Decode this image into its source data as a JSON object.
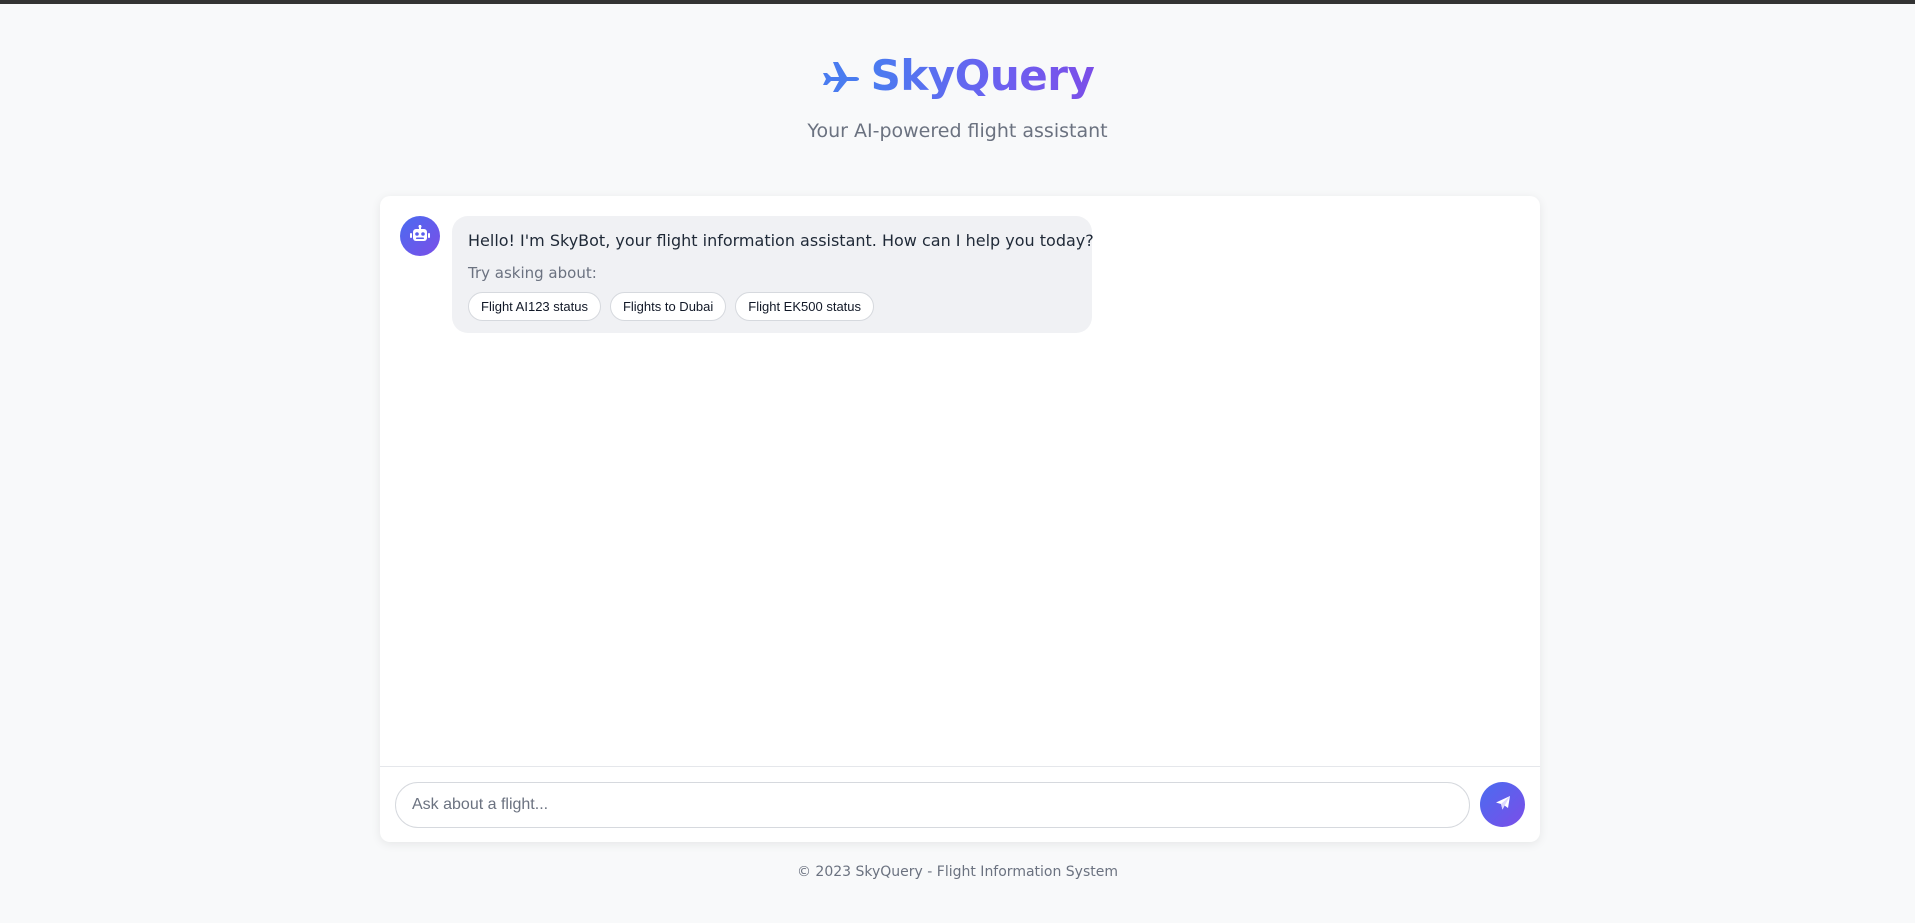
{
  "header": {
    "logo_icon": "airplane-icon",
    "title": "SkyQuery",
    "subtitle": "Your AI-powered flight assistant"
  },
  "colors": {
    "accent_start": "#4a7cf0",
    "accent_end": "#7b4ee8",
    "background": "#f8f9fa",
    "bubble": "#f0f1f4"
  },
  "chat": {
    "messages": [
      {
        "sender": "bot",
        "avatar_icon": "robot-icon",
        "text": "Hello! I'm SkyBot, your flight information assistant. How can I help you today?",
        "suggest_label": "Try asking about:",
        "suggestions": [
          "Flight AI123 status",
          "Flights to Dubai",
          "Flight EK500 status"
        ]
      }
    ],
    "input": {
      "placeholder": "Ask about a flight...",
      "value": ""
    },
    "send_icon": "paper-plane-icon"
  },
  "footer": {
    "text": "© 2023 SkyQuery - Flight Information System"
  }
}
